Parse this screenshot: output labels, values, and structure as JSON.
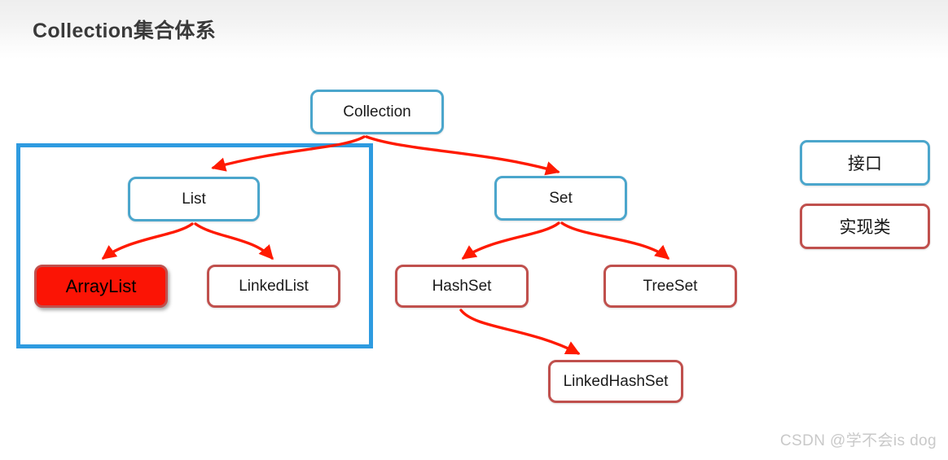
{
  "header": {
    "title": "Collection集合体系"
  },
  "diagram": {
    "type": "hierarchy-tree",
    "nodes": [
      {
        "id": "collection",
        "label": "Collection",
        "kind": "interface"
      },
      {
        "id": "list",
        "label": "List",
        "kind": "interface"
      },
      {
        "id": "set",
        "label": "Set",
        "kind": "interface"
      },
      {
        "id": "arraylist",
        "label": "ArrayList",
        "kind": "implementation",
        "highlighted": true
      },
      {
        "id": "linkedlist",
        "label": "LinkedList",
        "kind": "implementation"
      },
      {
        "id": "hashset",
        "label": "HashSet",
        "kind": "implementation"
      },
      {
        "id": "treeset",
        "label": "TreeSet",
        "kind": "implementation"
      },
      {
        "id": "linkedhashset",
        "label": "LinkedHashSet",
        "kind": "implementation"
      }
    ],
    "edges": [
      {
        "from": "collection",
        "to": "list"
      },
      {
        "from": "collection",
        "to": "set"
      },
      {
        "from": "list",
        "to": "arraylist"
      },
      {
        "from": "list",
        "to": "linkedlist"
      },
      {
        "from": "set",
        "to": "hashset"
      },
      {
        "from": "set",
        "to": "treeset"
      },
      {
        "from": "hashset",
        "to": "linkedhashset"
      }
    ]
  },
  "legend": {
    "interface_label": "接口",
    "implementation_label": "实现类"
  },
  "watermark": {
    "text": "CSDN @学不会is dog"
  },
  "colors": {
    "interface_border": "#4BA6CC",
    "implementation_border": "#C0504D",
    "highlight_fill": "#FB1405",
    "highlight_rect_border": "#2E9BE0",
    "arrow": "#FF1A00",
    "title_text": "#3A3A3A",
    "watermark_text": "#C9C9C9",
    "page_background": "#FFFFFF"
  }
}
